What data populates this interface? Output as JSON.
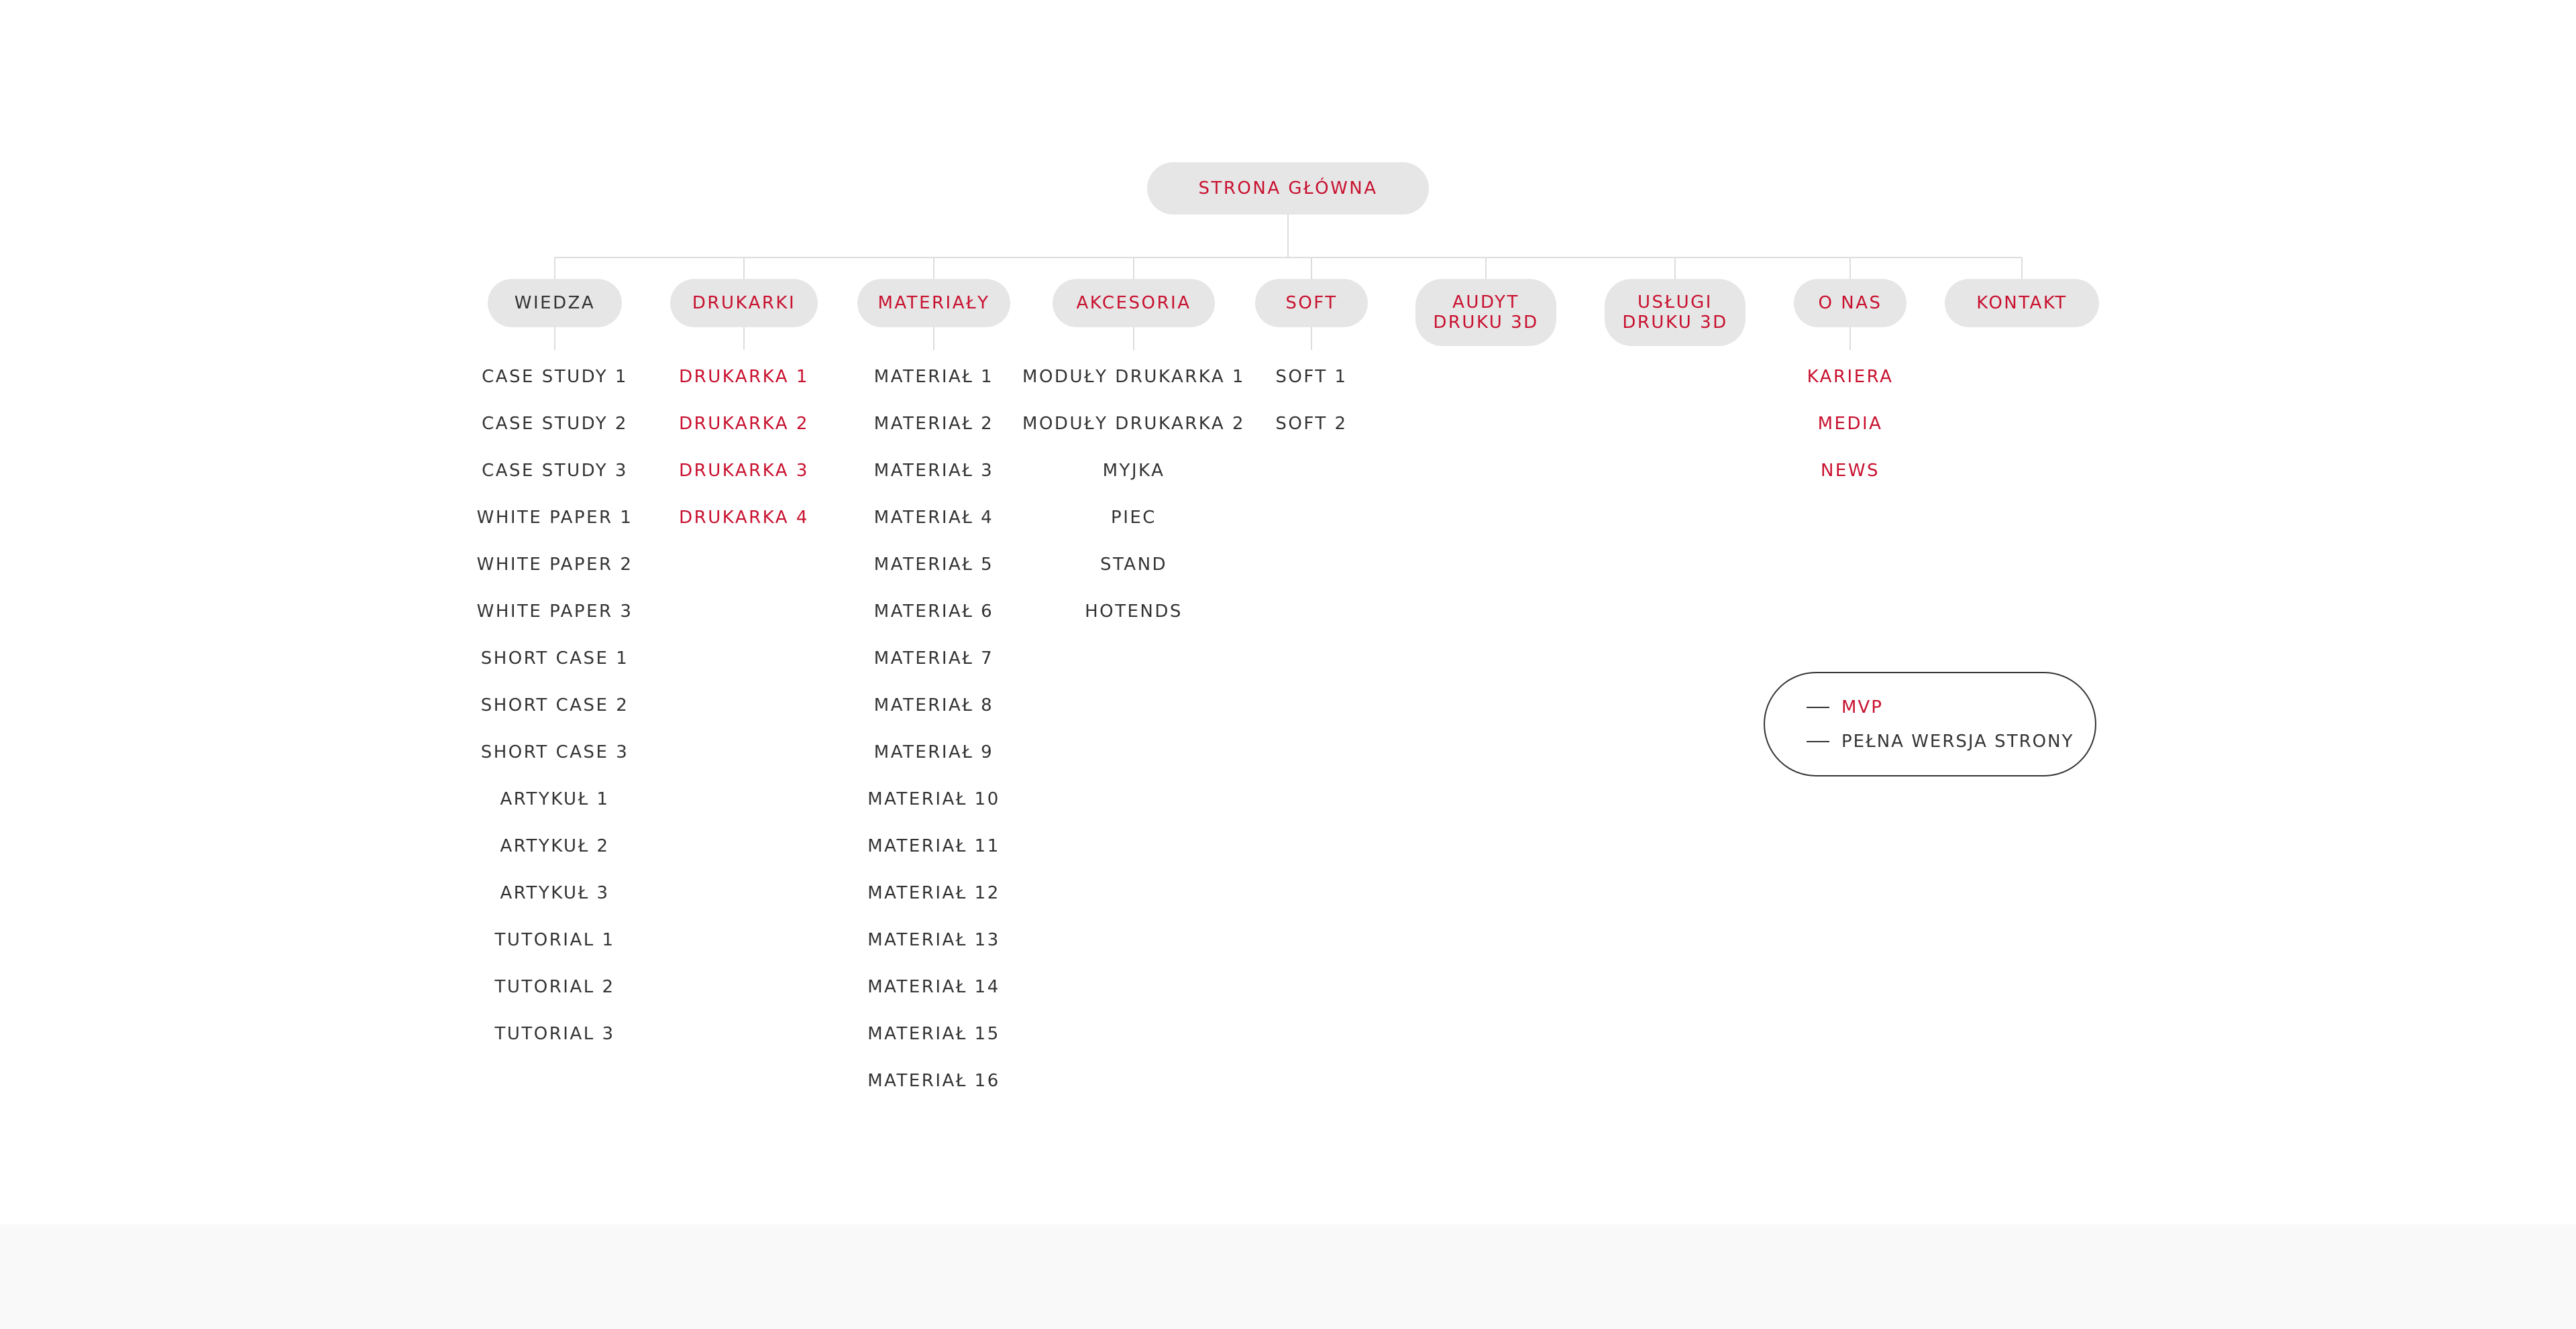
{
  "colors": {
    "accent": "#c8102e",
    "text": "#333333",
    "pill_bg": "#e6e6e6",
    "connector": "#dddddd",
    "footer_bg": "#f9f9f9"
  },
  "root": {
    "label": "STRONA GŁÓWNA",
    "status": "mvp"
  },
  "categories": [
    {
      "id": "wiedza",
      "label": "WIEDZA",
      "status": "full",
      "items": [
        {
          "label": "CASE STUDY 1",
          "status": "full"
        },
        {
          "label": "CASE STUDY 2",
          "status": "full"
        },
        {
          "label": "CASE STUDY 3",
          "status": "full"
        },
        {
          "label": "WHITE PAPER 1",
          "status": "full"
        },
        {
          "label": "WHITE PAPER 2",
          "status": "full"
        },
        {
          "label": "WHITE PAPER 3",
          "status": "full"
        },
        {
          "label": "SHORT CASE 1",
          "status": "full"
        },
        {
          "label": "SHORT CASE 2",
          "status": "full"
        },
        {
          "label": "SHORT CASE 3",
          "status": "full"
        },
        {
          "label": "ARTYKUŁ 1",
          "status": "full"
        },
        {
          "label": "ARTYKUŁ 2",
          "status": "full"
        },
        {
          "label": "ARTYKUŁ 3",
          "status": "full"
        },
        {
          "label": "TUTORIAL 1",
          "status": "full"
        },
        {
          "label": "TUTORIAL 2",
          "status": "full"
        },
        {
          "label": "TUTORIAL 3",
          "status": "full"
        }
      ]
    },
    {
      "id": "drukarki",
      "label": "DRUKARKI",
      "status": "mvp",
      "items": [
        {
          "label": "DRUKARKA 1",
          "status": "mvp"
        },
        {
          "label": "DRUKARKA 2",
          "status": "mvp"
        },
        {
          "label": "DRUKARKA 3",
          "status": "mvp"
        },
        {
          "label": "DRUKARKA 4",
          "status": "mvp"
        }
      ]
    },
    {
      "id": "materialy",
      "label": "MATERIAŁY",
      "status": "mvp",
      "items": [
        {
          "label": "MATERIAŁ 1",
          "status": "full"
        },
        {
          "label": "MATERIAŁ 2",
          "status": "full"
        },
        {
          "label": "MATERIAŁ 3",
          "status": "full"
        },
        {
          "label": "MATERIAŁ 4",
          "status": "full"
        },
        {
          "label": "MATERIAŁ 5",
          "status": "full"
        },
        {
          "label": "MATERIAŁ 6",
          "status": "full"
        },
        {
          "label": "MATERIAŁ 7",
          "status": "full"
        },
        {
          "label": "MATERIAŁ 8",
          "status": "full"
        },
        {
          "label": "MATERIAŁ 9",
          "status": "full"
        },
        {
          "label": "MATERIAŁ 10",
          "status": "full"
        },
        {
          "label": "MATERIAŁ 11",
          "status": "full"
        },
        {
          "label": "MATERIAŁ 12",
          "status": "full"
        },
        {
          "label": "MATERIAŁ 13",
          "status": "full"
        },
        {
          "label": "MATERIAŁ 14",
          "status": "full"
        },
        {
          "label": "MATERIAŁ 15",
          "status": "full"
        },
        {
          "label": "MATERIAŁ 16",
          "status": "full"
        }
      ]
    },
    {
      "id": "akcesoria",
      "label": "AKCESORIA",
      "status": "mvp",
      "items": [
        {
          "label": "MODUŁY DRUKARKA 1",
          "status": "full"
        },
        {
          "label": "MODUŁY DRUKARKA 2",
          "status": "full"
        },
        {
          "label": "MYJKA",
          "status": "full"
        },
        {
          "label": "PIEC",
          "status": "full"
        },
        {
          "label": "STAND",
          "status": "full"
        },
        {
          "label": "HOTENDS",
          "status": "full"
        }
      ]
    },
    {
      "id": "soft",
      "label": "SOFT",
      "status": "mvp",
      "items": [
        {
          "label": "SOFT 1",
          "status": "full"
        },
        {
          "label": "SOFT 2",
          "status": "full"
        }
      ]
    },
    {
      "id": "audyt",
      "label": "AUDYT\nDRUKU 3D",
      "status": "mvp",
      "items": []
    },
    {
      "id": "uslugi",
      "label": "USŁUGI\nDRUKU 3D",
      "status": "mvp",
      "items": []
    },
    {
      "id": "onas",
      "label": "O NAS",
      "status": "mvp",
      "items": [
        {
          "label": "KARIERA",
          "status": "mvp"
        },
        {
          "label": "MEDIA",
          "status": "mvp"
        },
        {
          "label": "NEWS",
          "status": "mvp"
        }
      ]
    },
    {
      "id": "kontakt",
      "label": "KONTAKT",
      "status": "mvp",
      "items": []
    }
  ],
  "legend": {
    "entries": [
      {
        "label": "MVP",
        "status": "mvp"
      },
      {
        "label": "PEŁNA WERSJA STRONY",
        "status": "full"
      }
    ]
  }
}
